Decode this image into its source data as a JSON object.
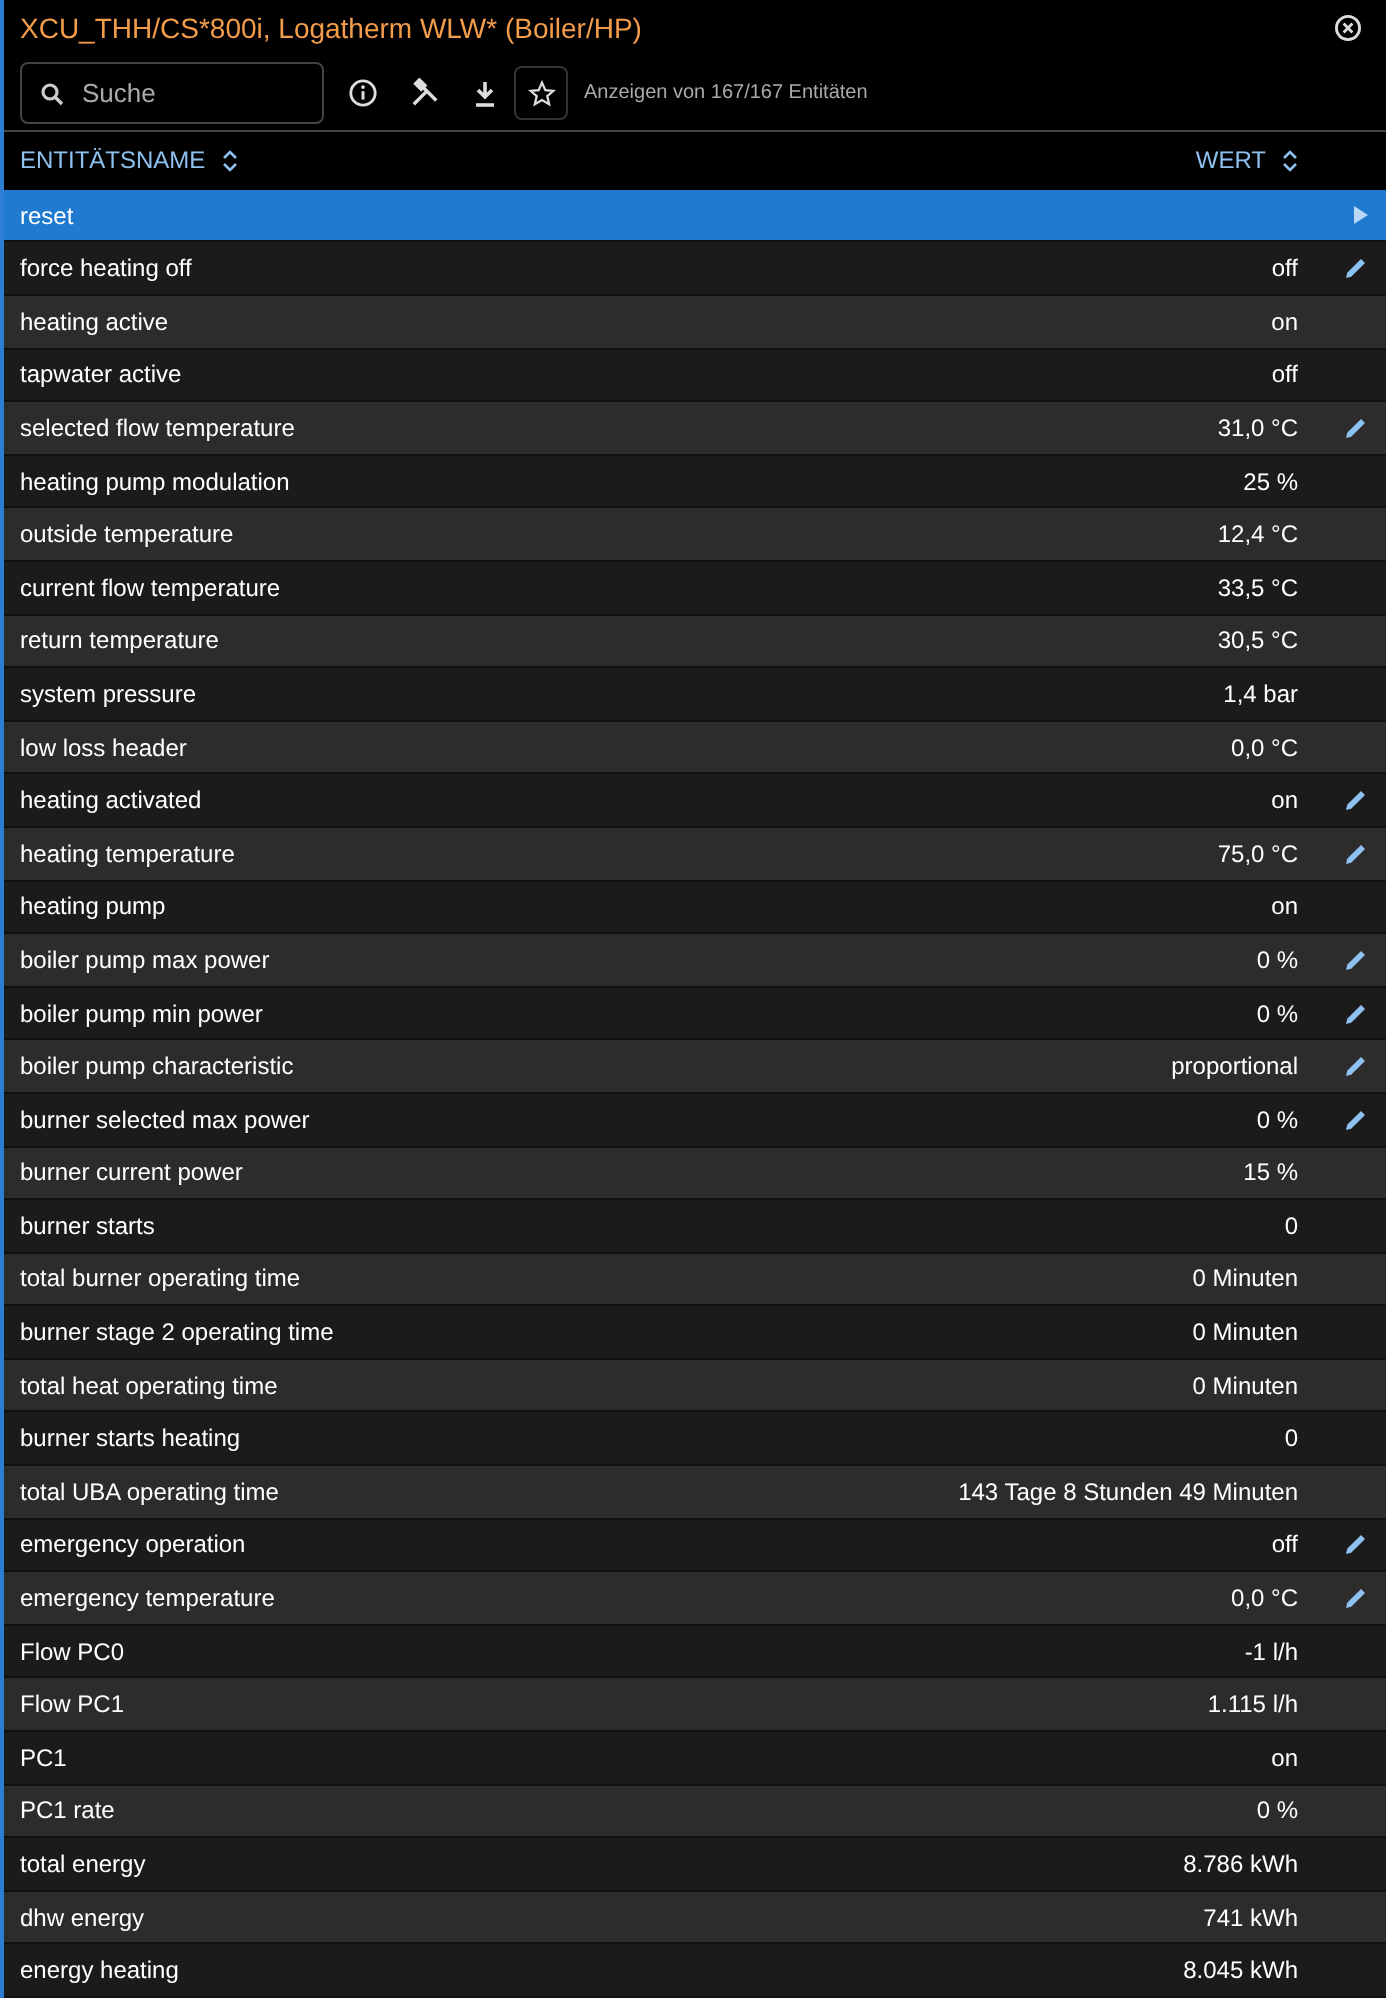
{
  "title": "XCU_THH/CS*800i, Logatherm WLW* (Boiler/HP)",
  "search": {
    "placeholder": "Suche"
  },
  "count_text": "Anzeigen von 167/167 Entitäten",
  "columns": [
    "ENTITÄTSNAME",
    "WERT"
  ],
  "rows": [
    {
      "name": "reset",
      "value": "",
      "selected": true,
      "editable": false
    },
    {
      "name": "force heating off",
      "value": "off",
      "selected": false,
      "editable": true
    },
    {
      "name": "heating active",
      "value": "on",
      "selected": false,
      "editable": false
    },
    {
      "name": "tapwater active",
      "value": "off",
      "selected": false,
      "editable": false
    },
    {
      "name": "selected flow temperature",
      "value": "31,0 °C",
      "selected": false,
      "editable": true
    },
    {
      "name": "heating pump modulation",
      "value": "25 %",
      "selected": false,
      "editable": false
    },
    {
      "name": "outside temperature",
      "value": "12,4 °C",
      "selected": false,
      "editable": false
    },
    {
      "name": "current flow temperature",
      "value": "33,5 °C",
      "selected": false,
      "editable": false
    },
    {
      "name": "return temperature",
      "value": "30,5 °C",
      "selected": false,
      "editable": false
    },
    {
      "name": "system pressure",
      "value": "1,4 bar",
      "selected": false,
      "editable": false
    },
    {
      "name": "low loss header",
      "value": "0,0 °C",
      "selected": false,
      "editable": false
    },
    {
      "name": "heating activated",
      "value": "on",
      "selected": false,
      "editable": true
    },
    {
      "name": "heating temperature",
      "value": "75,0 °C",
      "selected": false,
      "editable": true
    },
    {
      "name": "heating pump",
      "value": "on",
      "selected": false,
      "editable": false
    },
    {
      "name": "boiler pump max power",
      "value": "0 %",
      "selected": false,
      "editable": true
    },
    {
      "name": "boiler pump min power",
      "value": "0 %",
      "selected": false,
      "editable": true
    },
    {
      "name": "boiler pump characteristic",
      "value": "proportional",
      "selected": false,
      "editable": true
    },
    {
      "name": "burner selected max power",
      "value": "0 %",
      "selected": false,
      "editable": true
    },
    {
      "name": "burner current power",
      "value": "15 %",
      "selected": false,
      "editable": false
    },
    {
      "name": "burner starts",
      "value": "0",
      "selected": false,
      "editable": false
    },
    {
      "name": "total burner operating time",
      "value": "0 Minuten",
      "selected": false,
      "editable": false
    },
    {
      "name": "burner stage 2 operating time",
      "value": "0 Minuten",
      "selected": false,
      "editable": false
    },
    {
      "name": "total heat operating time",
      "value": "0 Minuten",
      "selected": false,
      "editable": false
    },
    {
      "name": "burner starts heating",
      "value": "0",
      "selected": false,
      "editable": false
    },
    {
      "name": "total UBA operating time",
      "value": "143 Tage 8 Stunden 49 Minuten",
      "selected": false,
      "editable": false
    },
    {
      "name": "emergency operation",
      "value": "off",
      "selected": false,
      "editable": true
    },
    {
      "name": "emergency temperature",
      "value": "0,0 °C",
      "selected": false,
      "editable": true
    },
    {
      "name": "Flow PC0",
      "value": "-1 l/h",
      "selected": false,
      "editable": false
    },
    {
      "name": "Flow PC1",
      "value": "1.115 l/h",
      "selected": false,
      "editable": false
    },
    {
      "name": "PC1",
      "value": "on",
      "selected": false,
      "editable": false
    },
    {
      "name": "PC1 rate",
      "value": "0 %",
      "selected": false,
      "editable": false
    },
    {
      "name": "total energy",
      "value": "8.786 kWh",
      "selected": false,
      "editable": false
    },
    {
      "name": "dhw energy",
      "value": "741 kWh",
      "selected": false,
      "editable": false
    },
    {
      "name": "energy heating",
      "value": "8.045 kWh",
      "selected": false,
      "editable": false
    }
  ]
}
